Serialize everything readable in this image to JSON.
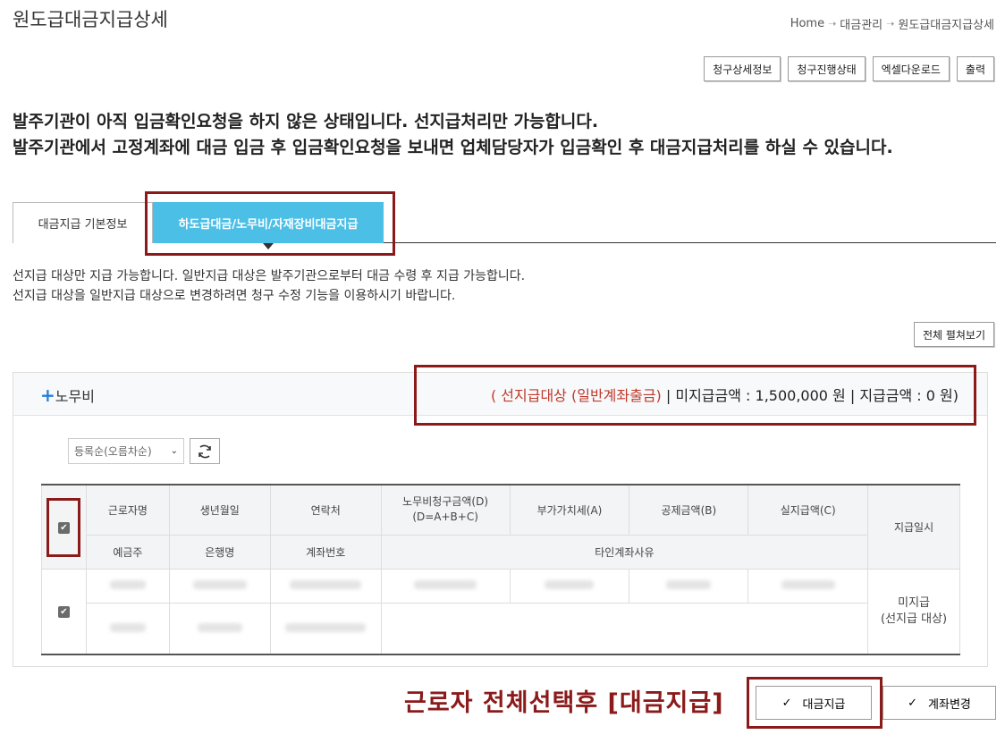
{
  "page": {
    "title": "원도급대금지급상세"
  },
  "breadcrumb": [
    "Home",
    "대금관리",
    "원도급대금지급상세"
  ],
  "top_buttons": [
    "청구상세정보",
    "청구진행상태",
    "엑셀다운로드",
    "출력"
  ],
  "notice": {
    "line1": "발주기관이 아직 입금확인요청을 하지 않은 상태입니다. 선지급처리만 가능합니다.",
    "line2": "발주기관에서 고정계좌에 대금 입금 후 입금확인요청을 보내면 업체담당자가 입금확인 후 대금지급처리를 하실 수 있습니다."
  },
  "tabs": [
    "대금지급 기본정보",
    "하도급대금/노무비/자재장비대금지급"
  ],
  "info": {
    "line1": "선지급 대상만 지급 가능합니다. 일반지급 대상은 발주기관으로부터 대금 수령 후 지급 가능합니다.",
    "line2": "선지급 대상을 일반지급 대상으로 변경하려면 청구 수정 기능을 이용하시기 바랍니다."
  },
  "expand_all": "전체 펼쳐보기",
  "section": {
    "title": "노무비",
    "summary_prefix": "( ",
    "summary_highlight": "선지급대상 (일반계좌출금)",
    "summary_rest": " | 미지급금액 : 1,500,000 원 | 지급금액 : 0 원)"
  },
  "sort": {
    "selected": "등록순(오름차순)"
  },
  "table": {
    "header_row1": [
      "근로자명",
      "생년월일",
      "연락처",
      "노무비청구금액(D)\n(D=A+B+C)",
      "부가가치세(A)",
      "공제금액(B)",
      "실지급액(C)",
      "지급일시"
    ],
    "header_row2": [
      "예금주",
      "은행명",
      "계좌번호",
      "타인계좌사유"
    ],
    "status": "미지급\n(선지급 대상)"
  },
  "annotation": "근로자 전체선택후 [대금지급]",
  "buttons": {
    "pay": "대금지급",
    "change_account": "계좌변경"
  },
  "colors": {
    "accent": "#4bbfe6",
    "annotation": "#8b1a1a",
    "summary_red": "#c0392b"
  }
}
